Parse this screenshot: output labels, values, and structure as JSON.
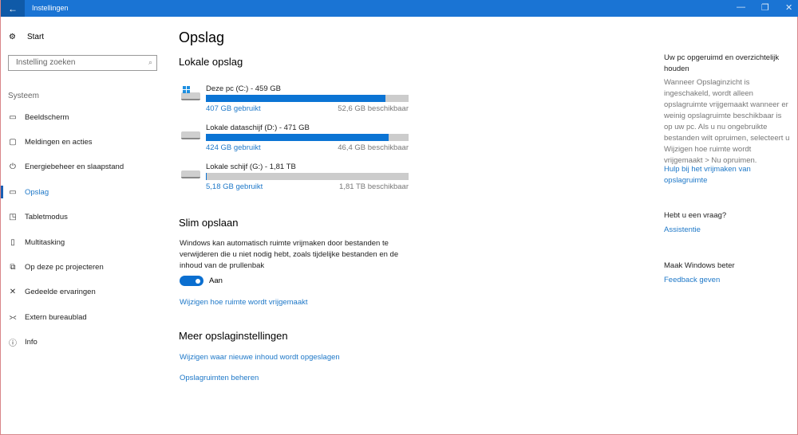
{
  "window": {
    "title": "Instellingen",
    "back": "←",
    "minimize": "—",
    "maximize": "❐",
    "close": "✕"
  },
  "sidebar": {
    "start": "Start",
    "search_placeholder": "Instelling zoeken",
    "section": "Systeem",
    "items": [
      {
        "label": "Beeldscherm",
        "icon": "monitor-icon",
        "glyph": "▭"
      },
      {
        "label": "Meldingen en acties",
        "icon": "notification-icon",
        "glyph": "▢"
      },
      {
        "label": "Energiebeheer en slaapstand",
        "icon": "power-icon",
        "glyph": "⏻"
      },
      {
        "label": "Opslag",
        "icon": "storage-icon",
        "glyph": "▭",
        "active": true
      },
      {
        "label": "Tabletmodus",
        "icon": "tablet-icon",
        "glyph": "◳"
      },
      {
        "label": "Multitasking",
        "icon": "multitasking-icon",
        "glyph": "▯"
      },
      {
        "label": "Op deze pc projecteren",
        "icon": "project-icon",
        "glyph": "⧉"
      },
      {
        "label": "Gedeelde ervaringen",
        "icon": "shared-icon",
        "glyph": "✕"
      },
      {
        "label": "Extern bureaublad",
        "icon": "remote-desktop-icon",
        "glyph": "⪥"
      },
      {
        "label": "Info",
        "icon": "info-icon",
        "glyph": "ⓘ"
      }
    ]
  },
  "main": {
    "title": "Opslag",
    "local_heading": "Lokale opslag",
    "drives": [
      {
        "name": "Deze pc (C:) - 459 GB",
        "used": "407 GB gebruikt",
        "free": "52,6 GB beschikbaar",
        "fraction_used": 0.887,
        "windows": true
      },
      {
        "name": "Lokale dataschijf (D:) - 471 GB",
        "used": "424 GB gebruikt",
        "free": "46,4 GB beschikbaar",
        "fraction_used": 0.9,
        "windows": false
      },
      {
        "name": "Lokale schijf (G:) - 1,81 TB",
        "used": "5,18 GB gebruikt",
        "free": "1,81 TB beschikbaar",
        "fraction_used": 0.003,
        "windows": false
      }
    ],
    "smart_heading": "Slim opslaan",
    "smart_text": "Windows kan automatisch ruimte vrijmaken door bestanden te verwijderen die u niet nodig hebt, zoals tijdelijke bestanden en de inhoud van de prullenbak",
    "toggle_label": "Aan",
    "toggle_on": true,
    "smart_link": "Wijzigen hoe ruimte wordt vrijgemaakt",
    "more_heading": "Meer opslaginstellingen",
    "more_links": [
      "Wijzigen waar nieuwe inhoud wordt opgeslagen",
      "Opslagruimten beheren"
    ]
  },
  "right": {
    "tidy_heading": "Uw pc opgeruimd en overzichtelijk houden",
    "tidy_text": "Wanneer Opslaginzicht is ingeschakeld, wordt alleen opslagruimte vrijgemaakt wanneer er weinig opslagruimte beschikbaar is op uw pc. Als u nu ongebruikte bestanden wilt opruimen, selecteert u Wijzigen hoe ruimte wordt vrijgemaakt > Nu opruimen.",
    "tidy_link": "Hulp bij het vrijmaken van opslagruimte",
    "question_heading": "Hebt u een vraag?",
    "question_link": "Assistentie",
    "better_heading": "Maak Windows beter",
    "better_link": "Feedback geven"
  }
}
